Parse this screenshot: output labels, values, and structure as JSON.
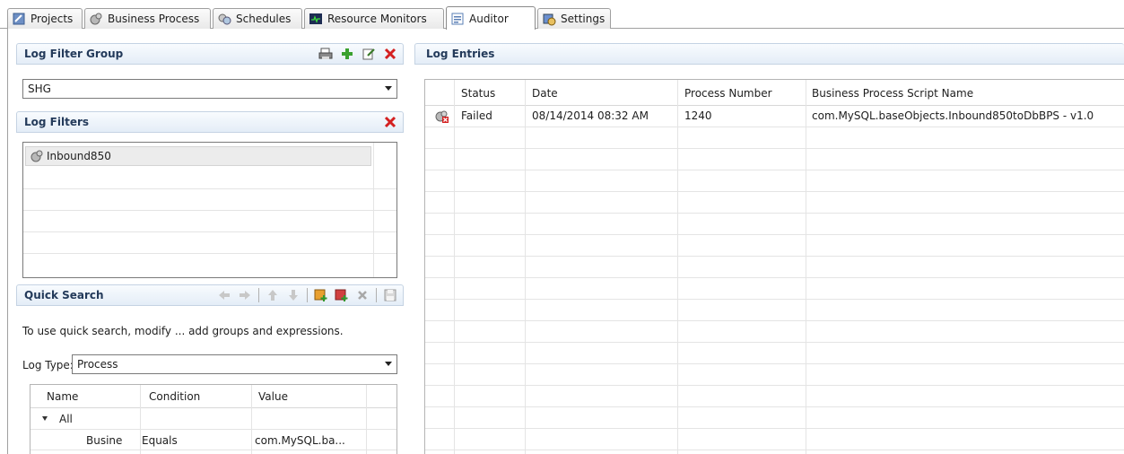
{
  "tabs": [
    {
      "label": "Projects",
      "icon": "projects-icon"
    },
    {
      "label": "Business Process",
      "icon": "business-process-icon"
    },
    {
      "label": "Schedules",
      "icon": "schedules-icon"
    },
    {
      "label": "Resource Monitors",
      "icon": "resource-monitor-icon"
    },
    {
      "label": "Auditor",
      "icon": "auditor-icon",
      "active": true
    },
    {
      "label": "Settings",
      "icon": "settings-icon"
    }
  ],
  "filter_group": {
    "title": "Log Filter Group",
    "selected": "SHG"
  },
  "log_filters": {
    "title": "Log Filters",
    "items": [
      "Inbound850"
    ]
  },
  "quick_search": {
    "title": "Quick Search",
    "hint": "To use quick search, modify ... add groups and expressions.",
    "log_type_label": "Log Type:",
    "log_type_value": "Process",
    "columns": [
      "Name",
      "Condition",
      "Value"
    ],
    "rows": [
      {
        "name": "All",
        "condition": "",
        "value": "",
        "expanded": true
      },
      {
        "name": "Busine",
        "condition": "Equals",
        "value": "com.MySQL.ba..."
      }
    ]
  },
  "log_entries": {
    "title": "Log Entries",
    "columns": [
      "Status",
      "Date",
      "Process Number",
      "Business Process Script Name"
    ],
    "rows": [
      {
        "status": "Failed",
        "date": "08/14/2014 08:32 AM",
        "process_number": "1240",
        "script_name": "com.MySQL.baseObjects.Inbound850toDbBPS - v1.0"
      }
    ]
  },
  "colors": {
    "header_text": "#233a5a",
    "delete_red": "#d42020",
    "add_green": "#3aa12f"
  }
}
